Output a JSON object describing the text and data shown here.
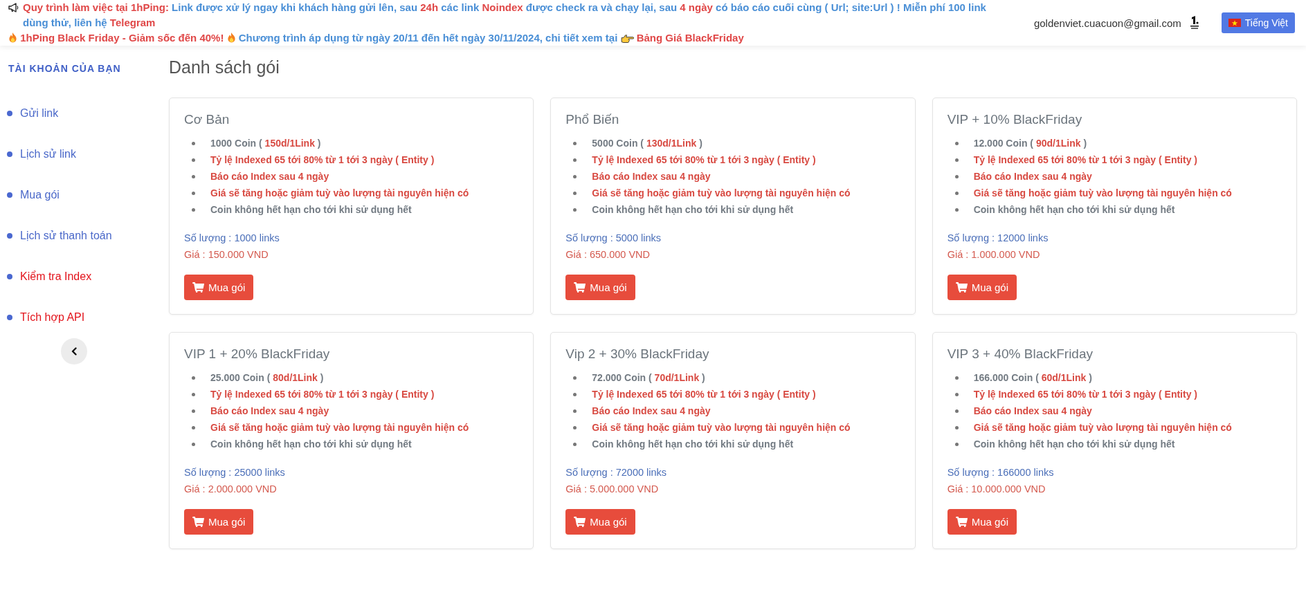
{
  "top_bar": {
    "notice": [
      {
        "text": "Quy trình làm việc tại 1hPing:",
        "highlight": true
      },
      {
        "text": "Link được xử lý ngay khi khách hàng gửi lên, sau",
        "highlight": false
      },
      {
        "text": "24h",
        "highlight": true
      },
      {
        "text": "các link",
        "highlight": false
      },
      {
        "text": "Noindex",
        "highlight": true
      },
      {
        "text": "được check ra và chạy lại, sau",
        "highlight": false
      },
      {
        "text": "4 ngày",
        "highlight": true
      },
      {
        "text": "có báo cáo cuối cùng ( Url; site:Url ) ! Miễn phí 100 link dùng thử, liên hệ",
        "highlight": false
      },
      {
        "text": "Telegram",
        "highlight": true
      }
    ],
    "promo": {
      "headline": "1hPing Black Friday - Giảm sốc đến 40%!",
      "details": "Chương trình áp dụng từ ngày 20/11 đến hết ngày 30/11/2024, chi tiết xem tại",
      "link": "Bảng Giá BlackFriday"
    },
    "email": "goldenviet.cuacuon@gmail.com",
    "language_button": "Tiếng Việt"
  },
  "sidebar": {
    "title": "TÀI KHOẢN CỦA BẠN",
    "items": [
      {
        "label": "Gửi link",
        "color": "#4a68c9"
      },
      {
        "label": "Lịch sử link",
        "color": "#4a68c9"
      },
      {
        "label": "Mua gói",
        "color": "#4a68c9"
      },
      {
        "label": "Lịch sử thanh toán",
        "color": "#4a68c9"
      },
      {
        "label": "Kiểm tra Index",
        "color": "#e3131b"
      },
      {
        "label": "Tích hợp API",
        "color": "#e3131b"
      }
    ]
  },
  "main": {
    "title": "Danh sách gói",
    "packages": [
      {
        "name": "Cơ Bản",
        "features": [
          {
            "parts": [
              {
                "text": "1000 Coin (",
                "highlight": false
              },
              {
                "text": "150d/1Link",
                "highlight": true
              },
              {
                "text": ")",
                "highlight": false
              }
            ]
          },
          {
            "parts": [
              {
                "text": "Tỷ lệ Indexed 65 tới 80% từ 1 tới 3 ngày ( Entity )",
                "highlight": true
              }
            ]
          },
          {
            "parts": [
              {
                "text": "Báo cáo Index sau 4 ngày",
                "highlight": true
              }
            ]
          },
          {
            "parts": [
              {
                "text": "Giá sẽ tăng hoặc giảm tuỳ vào lượng tài nguyên hiện có",
                "highlight": true
              }
            ]
          },
          {
            "parts": [
              {
                "text": "Coin không hết hạn cho tới khi sử dụng hết",
                "highlight": false
              }
            ]
          }
        ],
        "quantity": "Số lượng : 1000 links",
        "price": "Giá : 150.000 VND",
        "button": "Mua gói"
      },
      {
        "name": "Phổ Biến",
        "features": [
          {
            "parts": [
              {
                "text": "5000 Coin (",
                "highlight": false
              },
              {
                "text": "130d/1Link",
                "highlight": true
              },
              {
                "text": ")",
                "highlight": false
              }
            ]
          },
          {
            "parts": [
              {
                "text": "Tỷ lệ Indexed 65 tới 80% từ 1 tới 3 ngày ( Entity )",
                "highlight": true
              }
            ]
          },
          {
            "parts": [
              {
                "text": "Báo cáo Index sau 4 ngày",
                "highlight": true
              }
            ]
          },
          {
            "parts": [
              {
                "text": "Giá sẽ tăng hoặc giảm tuỳ vào lượng tài nguyên hiện có",
                "highlight": true
              }
            ]
          },
          {
            "parts": [
              {
                "text": "Coin không hết hạn cho tới khi sử dụng hết",
                "highlight": false
              }
            ]
          }
        ],
        "quantity": "Số lượng : 5000 links",
        "price": "Giá : 650.000 VND",
        "button": "Mua gói"
      },
      {
        "name": "VIP + 10% BlackFriday",
        "features": [
          {
            "parts": [
              {
                "text": "12.000 Coin (",
                "highlight": false
              },
              {
                "text": "90d/1Link",
                "highlight": true
              },
              {
                "text": ")",
                "highlight": false
              }
            ]
          },
          {
            "parts": [
              {
                "text": "Tỷ lệ Indexed 65 tới 80% từ 1 tới 3 ngày ( Entity )",
                "highlight": true
              }
            ]
          },
          {
            "parts": [
              {
                "text": "Báo cáo Index sau 4 ngày",
                "highlight": true
              }
            ]
          },
          {
            "parts": [
              {
                "text": "Giá sẽ tăng hoặc giảm tuỳ vào lượng tài nguyên hiện có",
                "highlight": true
              }
            ]
          },
          {
            "parts": [
              {
                "text": "Coin không hết hạn cho tới khi sử dụng hết",
                "highlight": false
              }
            ]
          }
        ],
        "quantity": "Số lượng : 12000 links",
        "price": "Giá : 1.000.000 VND",
        "button": "Mua gói"
      },
      {
        "name": "VIP 1 + 20% BlackFriday",
        "features": [
          {
            "parts": [
              {
                "text": "25.000 Coin (",
                "highlight": false
              },
              {
                "text": "80d/1Link",
                "highlight": true
              },
              {
                "text": ")",
                "highlight": false
              }
            ]
          },
          {
            "parts": [
              {
                "text": "Tỷ lệ Indexed 65 tới 80% từ 1 tới 3 ngày ( Entity )",
                "highlight": true
              }
            ]
          },
          {
            "parts": [
              {
                "text": "Báo cáo Index sau 4 ngày",
                "highlight": true
              }
            ]
          },
          {
            "parts": [
              {
                "text": "Giá sẽ tăng hoặc giảm tuỳ vào lượng tài nguyên hiện có",
                "highlight": true
              }
            ]
          },
          {
            "parts": [
              {
                "text": "Coin không hết hạn cho tới khi sử dụng hết",
                "highlight": false
              }
            ]
          }
        ],
        "quantity": "Số lượng : 25000 links",
        "price": "Giá : 2.000.000 VND",
        "button": "Mua gói"
      },
      {
        "name": "Vip 2 + 30% BlackFriday",
        "features": [
          {
            "parts": [
              {
                "text": "72.000 Coin (",
                "highlight": false
              },
              {
                "text": "70d/1Link",
                "highlight": true
              },
              {
                "text": ")",
                "highlight": false
              }
            ]
          },
          {
            "parts": [
              {
                "text": "Tỷ lệ Indexed 65 tới 80% từ 1 tới 3 ngày ( Entity )",
                "highlight": true
              }
            ]
          },
          {
            "parts": [
              {
                "text": "Báo cáo Index sau 4 ngày",
                "highlight": true
              }
            ]
          },
          {
            "parts": [
              {
                "text": "Giá sẽ tăng hoặc giảm tuỳ vào lượng tài nguyên hiện có",
                "highlight": true
              }
            ]
          },
          {
            "parts": [
              {
                "text": "Coin không hết hạn cho tới khi sử dụng hết",
                "highlight": false
              }
            ]
          }
        ],
        "quantity": "Số lượng : 72000 links",
        "price": "Giá : 5.000.000 VND",
        "button": "Mua gói"
      },
      {
        "name": "VIP 3 + 40% BlackFriday",
        "features": [
          {
            "parts": [
              {
                "text": "166.000 Coin (",
                "highlight": false
              },
              {
                "text": "60d/1Link",
                "highlight": true
              },
              {
                "text": ")",
                "highlight": false
              }
            ]
          },
          {
            "parts": [
              {
                "text": "Tỷ lệ Indexed 65 tới 80% từ 1 tới 3 ngày ( Entity )",
                "highlight": true
              }
            ]
          },
          {
            "parts": [
              {
                "text": "Báo cáo Index sau 4 ngày",
                "highlight": true
              }
            ]
          },
          {
            "parts": [
              {
                "text": "Giá sẽ tăng hoặc giảm tuỳ vào lượng tài nguyên hiện có",
                "highlight": true
              }
            ]
          },
          {
            "parts": [
              {
                "text": "Coin không hết hạn cho tới khi sử dụng hết",
                "highlight": false
              }
            ]
          }
        ],
        "quantity": "Số lượng : 166000 links",
        "price": "Giá : 10.000.000 VND",
        "button": "Mua gói"
      }
    ]
  }
}
